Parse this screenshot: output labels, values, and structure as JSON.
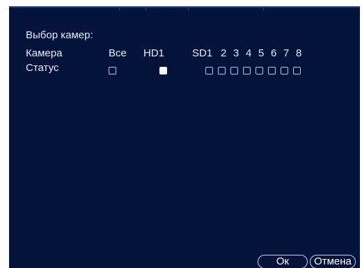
{
  "dialog": {
    "title": "Выбор камер:",
    "camera_row_label": "Камера",
    "status_row_label": "Статус",
    "all_label": "Все",
    "hd_label": "HD1",
    "sd_label": "SD1",
    "sd_channels": [
      "2",
      "3",
      "4",
      "5",
      "6",
      "7",
      "8"
    ],
    "status": {
      "all_checked": false,
      "hd1_checked": true,
      "sd_checked": [
        false,
        false,
        false,
        false,
        false,
        false,
        false,
        false
      ]
    }
  },
  "buttons": {
    "ok_label": "Ок",
    "cancel_label": "Отмена"
  },
  "colors": {
    "panel_background": "#04133a",
    "text": "#e6ecff"
  }
}
